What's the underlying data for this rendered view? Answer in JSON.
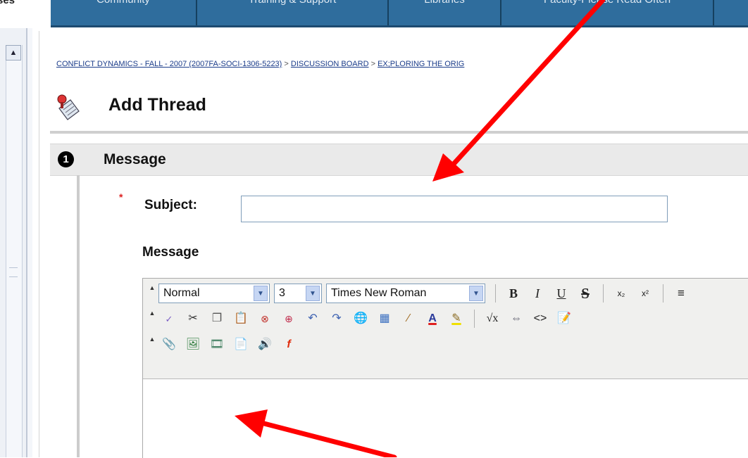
{
  "nav": {
    "cut_tab": "ses",
    "tabs": [
      {
        "label": "Community",
        "width": 206
      },
      {
        "label": "Training & Support",
        "width": 270
      },
      {
        "label": "Libraries",
        "width": 158
      },
      {
        "label": "Faculty-Please Read Often",
        "width": 300
      }
    ]
  },
  "breadcrumb": {
    "course": "CONFLICT DYNAMICS - FALL - 2007 (2007FA-SOCI-1306-5223)",
    "sep1": " > ",
    "board": "DISCUSSION BOARD",
    "sep2": " > ",
    "forum": "EX;PLORING THE ORIG"
  },
  "page": {
    "title": "Add Thread"
  },
  "section": {
    "number": "1",
    "title": "Message"
  },
  "form": {
    "required_mark": "*",
    "subject_label": "Subject:",
    "subject_value": "",
    "message_label": "Message"
  },
  "editor": {
    "format_value": "Normal",
    "size_value": "3",
    "font_value": "Times New Roman",
    "bold": "B",
    "italic": "I",
    "underline": "U",
    "strike": "S",
    "subscript": "x₂",
    "superscript": "x²",
    "align": "≡",
    "content": ""
  },
  "colors": {
    "nav_blue": "#2f6d9d",
    "annotation_red": "#ff0000",
    "required_red": "#dd2222"
  }
}
